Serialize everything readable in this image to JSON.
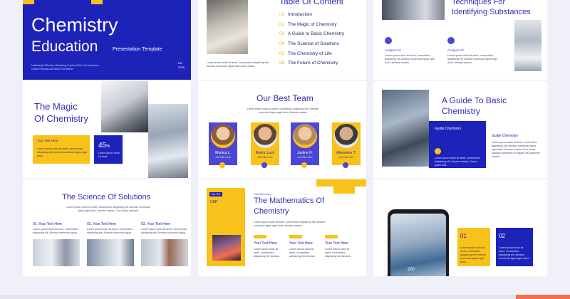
{
  "colors": {
    "brand_blue": "#1d22b8",
    "accent_yellow": "#f9c21a",
    "indigo": "#4c46d6",
    "orange": "#f26e4f"
  },
  "s1": {
    "title_1": "Chemistry",
    "title_2": "Education",
    "subtitle": "Presentation Template",
    "tagline": "Unlimitedly Effective Marketing Content With Your Audience, Driven Results And Build Your Brand",
    "est_label": "Est",
    "est_year": "2025"
  },
  "s2": {
    "title": "Table Of Content",
    "caption": "Lorem ipsum dolor sit amet, consectetur adipiscing elit. Aenean commodo ligula eget dolor massa.",
    "items": [
      {
        "num": "01",
        "label": "Introduction"
      },
      {
        "num": "02",
        "label": "The Magic of Chemistry"
      },
      {
        "num": "03",
        "label": "A Guide to Basic Chemistry"
      },
      {
        "num": "04",
        "label": "The Science of Solutions"
      },
      {
        "num": "05",
        "label": "The Chemistry of Life"
      },
      {
        "num": "06",
        "label": "The Future of Chemistry"
      }
    ]
  },
  "s3": {
    "title_1": "Techniques For",
    "title_2": "Identifying Substances",
    "analysis_1": "Analysis 01",
    "analysis_2": "Analysis 02",
    "body": "Lorem ipsum dolor sit amet, consectetur adipiscing elit. Aenean commodo ligula eget dolor. Aenean massa."
  },
  "s4": {
    "title_1": "The Magic",
    "title_2": "Of Chemistry",
    "box_title": "Your Text Here",
    "box_body": "Lorem ipsum dolor sit amet, consectetur adipiscing elit. Aenean commodo ligula eget dolor.",
    "stat": "45",
    "stat_unit": "%",
    "stat_body": "Lorem ipsum dolor sit amet."
  },
  "s5": {
    "title": "Our Best Team",
    "caption": "Lorem ipsum dolor sit amet, consectetur adipiscing elit. Aenean commodo ligula eget dolor. Aenean massa.",
    "members": [
      {
        "name": "Monica L.",
        "role": "Job Title Here"
      },
      {
        "name": "Rodric Luck",
        "role": "Job Title Here"
      },
      {
        "name": "Justine R.",
        "role": "Job Title Here"
      },
      {
        "name": "Alexander T.",
        "role": "Job Title Here"
      }
    ]
  },
  "s6": {
    "title_1": "A Guide To Basic",
    "title_2": "Chemistry",
    "card_title": "Guide Chemistry",
    "card_body": "Lorem ipsum dolor sit amet, consectetur adipiscing elit. Aenean massa. Donec quam felis.",
    "side_title": "Guide Chemistry",
    "side_body": "Lorem ipsum dolor sit amet, consectetur adipiscing elit. Aenean commodo ligula eget dolor. Aenean massa. Cum sociis natoque penatibus et magnis dis parturient montes."
  },
  "s7": {
    "title": "The Science Of Solutions",
    "caption": "Lorem ipsum dolor sit amet, consectetur adipiscing elit. Aenean commodo ligula eget dolor. Aenean massa. Cum sociis natoque.",
    "cols": [
      {
        "label": "01. Your Text Here",
        "body": "Lorem ipsum dolor sit amet, consectetur adipiscing elit. Aenean commodo ligula."
      },
      {
        "label": "02. Your Text Here",
        "body": "Lorem ipsum dolor sit amet, consectetur adipiscing elit. Aenean commodo ligula."
      },
      {
        "label": "03. Your Text Here",
        "body": "Lorem ipsum dolor sit amet, consectetur adipiscing elit. Aenean commodo ligula."
      }
    ]
  },
  "s8": {
    "tag": "Your Text",
    "usp": "USP",
    "kicker": "Stoichiometry",
    "title_1": "The Mathematics Of",
    "title_2": "Chemistry",
    "caption": "Lorem ipsum dolor sit amet, consectetur adipiscing elit. Aenean commodo ligula eget dolor. Aenean massa.",
    "cols": [
      {
        "label": "Your Text Here",
        "body": "Lorem ipsum dolor sit amet, consectetur adipiscing elit. Aenean."
      },
      {
        "label": "Your Text Here",
        "body": "Lorem ipsum dolor sit amet, consectetur adipiscing elit. Aenean."
      },
      {
        "label": "Your Text Here",
        "body": "Lorem ipsum dolor sit amet, consectetur adipiscing elit. Aenean."
      }
    ]
  },
  "s9": {
    "box_1": "01",
    "box_2": "02",
    "phone_value": "200",
    "body": "Lorem ipsum dolor sit amet, consectetur adipiscing elit. Aenean commodo ligula eget dolor."
  }
}
